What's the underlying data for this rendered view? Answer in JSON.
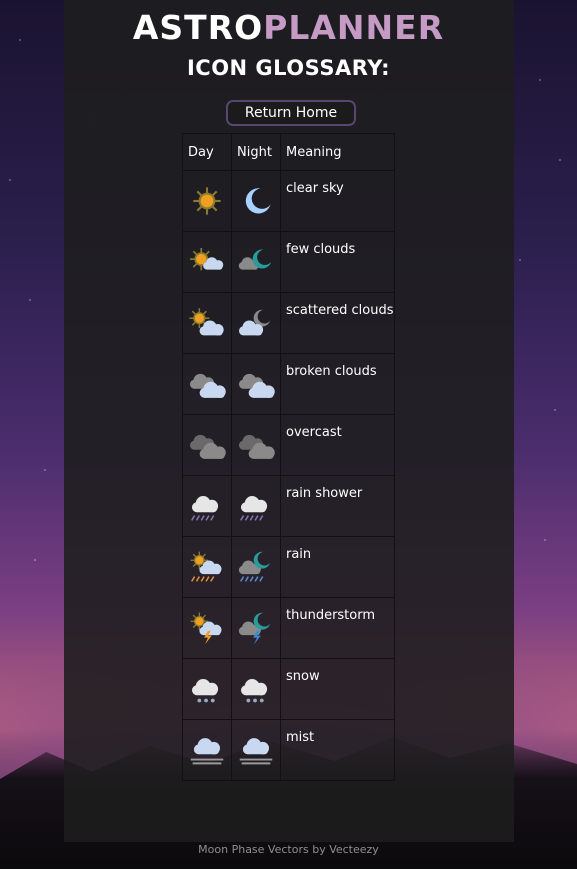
{
  "header": {
    "logo_part1": "ASTRO",
    "logo_part2": "PLANNER",
    "subtitle": "ICON GLOSSARY:",
    "return_home": "Return Home"
  },
  "table": {
    "columns": [
      "Day",
      "Night",
      "Meaning"
    ],
    "rows": [
      {
        "meaning": "clear sky",
        "day_icon": "sun-icon",
        "night_icon": "moon-icon"
      },
      {
        "meaning": "few clouds",
        "day_icon": "sun-cloud-icon",
        "night_icon": "moon-cloud-icon"
      },
      {
        "meaning": "scattered clouds",
        "day_icon": "sun-clouds-icon",
        "night_icon": "moon-clouds-icon"
      },
      {
        "meaning": "broken clouds",
        "day_icon": "broken-clouds-icon",
        "night_icon": "broken-clouds-icon"
      },
      {
        "meaning": "overcast",
        "day_icon": "overcast-icon",
        "night_icon": "overcast-icon"
      },
      {
        "meaning": "rain shower",
        "day_icon": "rain-shower-icon",
        "night_icon": "rain-shower-icon"
      },
      {
        "meaning": "rain",
        "day_icon": "sun-rain-icon",
        "night_icon": "moon-rain-icon"
      },
      {
        "meaning": "thunderstorm",
        "day_icon": "sun-thunder-icon",
        "night_icon": "moon-thunder-icon"
      },
      {
        "meaning": "snow",
        "day_icon": "snow-icon",
        "night_icon": "snow-icon"
      },
      {
        "meaning": "mist",
        "day_icon": "mist-icon",
        "night_icon": "mist-icon"
      }
    ]
  },
  "footer": {
    "credit": "Moon Phase Vectors by Vecteezy"
  },
  "colors": {
    "accent": "#c59ac4",
    "panel": "#1e1e1e",
    "button_border": "#5a4470"
  }
}
